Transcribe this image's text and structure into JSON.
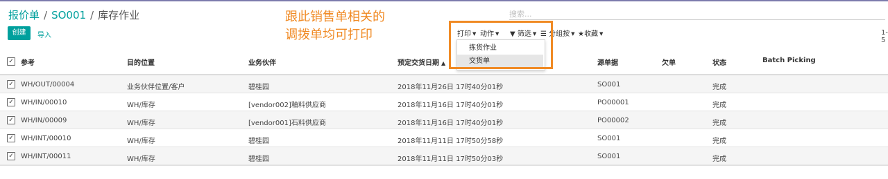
{
  "breadcrumb": {
    "root": "报价单",
    "order": "SO001",
    "current": "库存作业",
    "sep": "/"
  },
  "search": {
    "placeholder": "搜索..."
  },
  "buttons": {
    "create": "创建",
    "import": "导入"
  },
  "toolbar": {
    "print": "打印",
    "action": "动作",
    "filter": "筛选",
    "group_by": "分组按",
    "favorites": "收藏"
  },
  "pager": {
    "text": "1-5"
  },
  "annotation": {
    "line1": "跟此销售单相关的",
    "line2": "调拨单均可打印"
  },
  "print_menu": {
    "items": [
      "拣货作业",
      "交货单"
    ]
  },
  "colors": {
    "accent": "#00a09d",
    "annotation": "#f08a24",
    "brand_bar": "#7c7bad"
  },
  "table": {
    "headers": [
      "参考",
      "目的位置",
      "业务伙伴",
      "预定交货日期",
      "源单据",
      "欠单",
      "状态",
      "Batch Picking"
    ],
    "rows": [
      [
        "WH/OUT/00004",
        "业务伙伴位置/客户",
        "碧桂园",
        "2018年11月26日 17时40分01秒",
        "SO001",
        "",
        "完成",
        ""
      ],
      [
        "WH/IN/00010",
        "WH/库存",
        "[vendor002]釉料供应商",
        "2018年11月16日 17时40分01秒",
        "PO00001",
        "",
        "完成",
        ""
      ],
      [
        "WH/IN/00009",
        "WH/库存",
        "[vendor001]石料供应商",
        "2018年11月16日 17时40分01秒",
        "PO00002",
        "",
        "完成",
        ""
      ],
      [
        "WH/INT/00010",
        "WH/库存",
        "碧桂园",
        "2018年11月11日 17时50分58秒",
        "SO001",
        "",
        "完成",
        ""
      ],
      [
        "WH/INT/00011",
        "WH/库存",
        "碧桂园",
        "2018年11月11日 17时50分03秒",
        "SO001",
        "",
        "完成",
        ""
      ]
    ]
  }
}
